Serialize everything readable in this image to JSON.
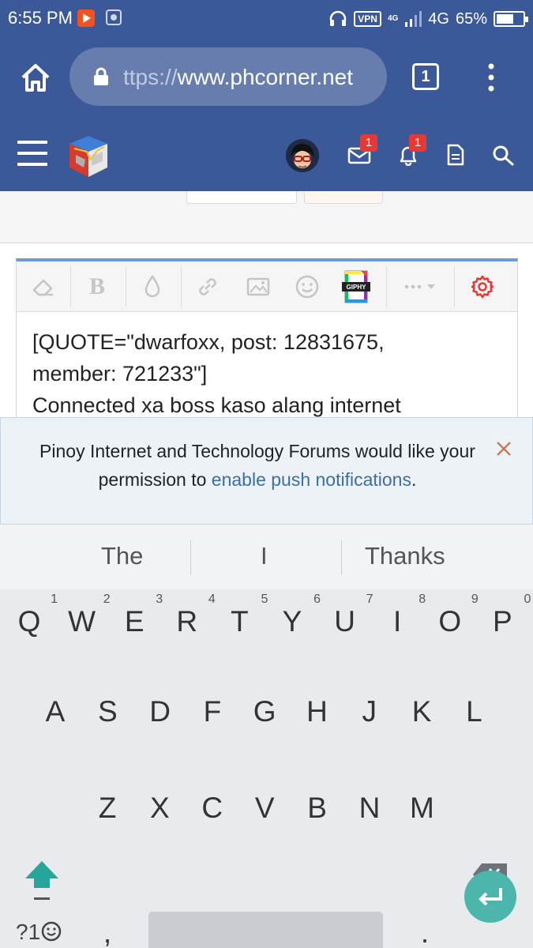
{
  "status_bar": {
    "time": "6:55 PM",
    "vpn": "VPN",
    "net_small": "4G",
    "network": "4G",
    "battery_percent": "65%",
    "battery_level": 0.65
  },
  "browser": {
    "url_faded": "ttps://",
    "url_main": "www.phcorner.net",
    "tab_count": "1"
  },
  "site_header": {
    "messages_badge": "1",
    "alerts_badge": "1"
  },
  "editor": {
    "line1": "[QUOTE=\"dwarfoxx, post: 12831675,",
    "line2": "member: 721233\"]",
    "line3": "Connected xa boss kaso alang internet",
    "giphy_label": "GIPHY"
  },
  "push_notice": {
    "text_before": "Pinoy Internet and Technology Forums would like your permission to ",
    "link": "enable push notifications",
    "text_after": "."
  },
  "keyboard": {
    "suggestions": [
      "The",
      "I",
      "Thanks"
    ],
    "row1": [
      "Q",
      "W",
      "E",
      "R",
      "T",
      "Y",
      "U",
      "I",
      "O",
      "P"
    ],
    "row1_numbers": [
      "1",
      "2",
      "3",
      "4",
      "5",
      "6",
      "7",
      "8",
      "9",
      "0"
    ],
    "row2": [
      "A",
      "S",
      "D",
      "F",
      "G",
      "H",
      "J",
      "K",
      "L"
    ],
    "row3": [
      "Z",
      "X",
      "C",
      "V",
      "B",
      "N",
      "M"
    ],
    "symbols_label": "?1",
    "comma": ",",
    "period": "."
  },
  "colors": {
    "header": "#3b5998",
    "editor_accent": "#6a9bd8",
    "link": "#3b6ea5",
    "enter_key": "#4db6ac",
    "shift_key": "#26a69a",
    "badge": "#e53935"
  }
}
